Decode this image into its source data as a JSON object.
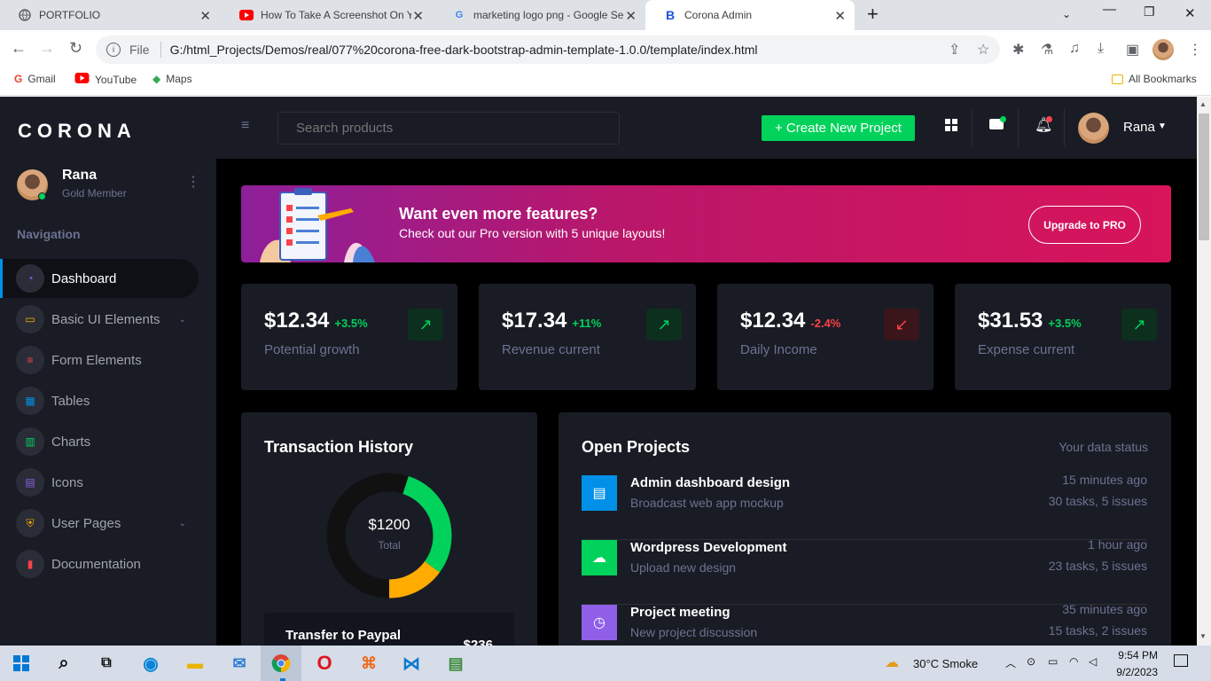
{
  "browser": {
    "tabs": [
      {
        "title": "PORTFOLIO",
        "icon": "globe-icon"
      },
      {
        "title": "How To Take A Screenshot On Yo",
        "icon": "youtube-icon"
      },
      {
        "title": "marketing logo png - Google Se",
        "icon": "google-icon"
      },
      {
        "title": "Corona Admin",
        "icon": "bootstrap-icon"
      }
    ],
    "new_tab": "+",
    "url_label": "File",
    "url": "G:/html_Projects/Demos/real/077%20corona-free-dark-bootstrap-admin-template-1.0.0/template/index.html",
    "bookmarks": [
      "Gmail",
      "YouTube",
      "Maps"
    ],
    "all_bookmarks": "All Bookmarks"
  },
  "app": {
    "brand": "CORONA",
    "profile": {
      "name": "Rana",
      "role": "Gold Member"
    },
    "nav_heading": "Navigation",
    "menu": [
      {
        "label": "Dashboard",
        "icon": "speedometer-icon",
        "color": "#8f5fe8"
      },
      {
        "label": "Basic UI Elements",
        "icon": "laptop-icon",
        "color": "#ffab00"
      },
      {
        "label": "Form Elements",
        "icon": "playlist-icon",
        "color": "#fc424a"
      },
      {
        "label": "Tables",
        "icon": "table-icon",
        "color": "#0090e7"
      },
      {
        "label": "Charts",
        "icon": "chart-bar-icon",
        "color": "#00d25b"
      },
      {
        "label": "Icons",
        "icon": "contacts-icon",
        "color": "#8f5fe8"
      },
      {
        "label": "User Pages",
        "icon": "security-icon",
        "color": "#ffab00"
      },
      {
        "label": "Documentation",
        "icon": "file-document-icon",
        "color": "#fc424a"
      }
    ],
    "topbar": {
      "search_placeholder": "Search products",
      "create_button": "+ Create New Project",
      "user_name": "Rana"
    },
    "banner": {
      "title": "Want even more features?",
      "subtitle": "Check out our Pro version with 5 unique layouts!",
      "button": "Upgrade to PRO"
    },
    "stats": [
      {
        "value": "$12.34",
        "change": "+3.5%",
        "label": "Potential growth",
        "trend": "up"
      },
      {
        "value": "$17.34",
        "change": "+11%",
        "label": "Revenue current",
        "trend": "up"
      },
      {
        "value": "$12.34",
        "change": "-2.4%",
        "label": "Daily Income",
        "trend": "down"
      },
      {
        "value": "$31.53",
        "change": "+3.5%",
        "label": "Expense current",
        "trend": "up"
      }
    ],
    "transactions": {
      "title": "Transaction History",
      "total_value": "$1200",
      "total_label": "Total",
      "item_title": "Transfer to Paypal",
      "item_amount": "$236",
      "donut": [
        {
          "value": 55,
          "color": "#111111"
        },
        {
          "value": 30,
          "color": "#00d25b"
        },
        {
          "value": 15,
          "color": "#ffab00"
        }
      ]
    },
    "projects": {
      "title": "Open Projects",
      "status": "Your data status",
      "items": [
        {
          "title": "Admin dashboard design",
          "sub": "Broadcast web app mockup",
          "time": "15 minutes ago",
          "meta": "30 tasks, 5 issues",
          "color": "#0090e7",
          "icon": "file-icon"
        },
        {
          "title": "Wordpress Development",
          "sub": "Upload new design",
          "time": "1 hour ago",
          "meta": "23 tasks, 5 issues",
          "color": "#00d25b",
          "icon": "cloud-upload-icon"
        },
        {
          "title": "Project meeting",
          "sub": "New project discussion",
          "time": "35 minutes ago",
          "meta": "15 tasks, 2 issues",
          "color": "#8f5fe8",
          "icon": "clock-icon"
        }
      ]
    }
  },
  "taskbar": {
    "weather": "30°C  Smoke",
    "time": "9:54 PM",
    "date": "9/2/2023"
  }
}
